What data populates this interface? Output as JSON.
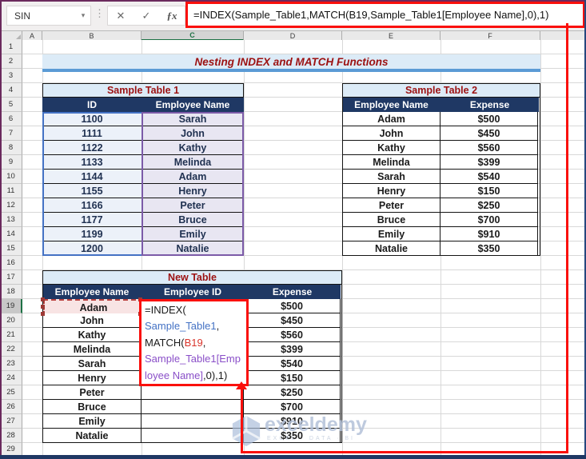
{
  "window": {
    "name_box": "SIN"
  },
  "formula_bar": {
    "formula": "=INDEX(Sample_Table1,MATCH(B19,Sample_Table1[Employee Name],0),1)",
    "cancel_label": "✕",
    "enter_label": "✓",
    "fx_label": "ƒx",
    "dropdown_glyph": "▾",
    "dots_glyph": "⋮"
  },
  "sheet": {
    "title": "Nesting INDEX and MATCH Functions",
    "columns": [
      "A",
      "B",
      "C",
      "D",
      "E",
      "F"
    ],
    "active_column": "C",
    "row_count": 29,
    "active_row": 19
  },
  "table1": {
    "title": "Sample Table 1",
    "headers": [
      "ID",
      "Employee Name"
    ],
    "rows": [
      [
        "1100",
        "Sarah"
      ],
      [
        "1111",
        "John"
      ],
      [
        "1122",
        "Kathy"
      ],
      [
        "1133",
        "Melinda"
      ],
      [
        "1144",
        "Adam"
      ],
      [
        "1155",
        "Henry"
      ],
      [
        "1166",
        "Peter"
      ],
      [
        "1177",
        "Bruce"
      ],
      [
        "1199",
        "Emily"
      ],
      [
        "1200",
        "Natalie"
      ]
    ]
  },
  "table2": {
    "title": "Sample Table 2",
    "headers": [
      "Employee Name",
      "Expense"
    ],
    "rows": [
      [
        "Adam",
        "$500"
      ],
      [
        "John",
        "$450"
      ],
      [
        "Kathy",
        "$560"
      ],
      [
        "Melinda",
        "$399"
      ],
      [
        "Sarah",
        "$540"
      ],
      [
        "Henry",
        "$150"
      ],
      [
        "Peter",
        "$250"
      ],
      [
        "Bruce",
        "$700"
      ],
      [
        "Emily",
        "$910"
      ],
      [
        "Natalie",
        "$350"
      ]
    ]
  },
  "new_table": {
    "title": "New Table",
    "headers": [
      "Employee Name",
      "Employee ID",
      "Expense"
    ],
    "rows": [
      [
        "Adam",
        "",
        "$500"
      ],
      [
        "John",
        "",
        "$450"
      ],
      [
        "Kathy",
        "",
        "$560"
      ],
      [
        "Melinda",
        "",
        "$399"
      ],
      [
        "Sarah",
        "",
        "$540"
      ],
      [
        "Henry",
        "",
        "$150"
      ],
      [
        "Peter",
        "",
        "$250"
      ],
      [
        "Bruce",
        "",
        "$700"
      ],
      [
        "Emily",
        "",
        "$910"
      ],
      [
        "Natalie",
        "",
        "$350"
      ]
    ],
    "active_reference_cell": "B19"
  },
  "cell_editor": {
    "lines": [
      [
        {
          "t": "=INDEX(",
          "c": "fk"
        }
      ],
      [
        {
          "t": "Sample_Table1",
          "c": "fb"
        },
        {
          "t": ",",
          "c": "fk"
        }
      ],
      [
        {
          "t": "MATCH(",
          "c": "fk"
        },
        {
          "t": "B19",
          "c": "fr"
        },
        {
          "t": ",",
          "c": "fk"
        }
      ],
      [
        {
          "t": "Sample_Table1[Emp",
          "c": "fp"
        }
      ],
      [
        {
          "t": "loyee Name]",
          "c": "fp"
        },
        {
          "t": ",0),1)",
          "c": "fk"
        }
      ]
    ]
  },
  "watermark": {
    "brand": "exceldemy",
    "tagline": "EXCEL · DATA · BI"
  },
  "colors": {
    "annotation_red": "#FA100C",
    "header_navy": "#1F3864",
    "title_red": "#9C1111",
    "accent_blue": "#5B9BD5",
    "range_blue": "#4472C4",
    "range_purple": "#7C5BA8",
    "formula_blue": "#4472C4",
    "formula_red": "#D9342B",
    "formula_purple": "#8A4FC8",
    "active_green": "#1E7145",
    "light_blue_fill": "#DCEBF7",
    "id_fill": "#ECF1F9",
    "name_fill": "#E8E6F2",
    "active_cell_pink": "#F8E4E4"
  }
}
